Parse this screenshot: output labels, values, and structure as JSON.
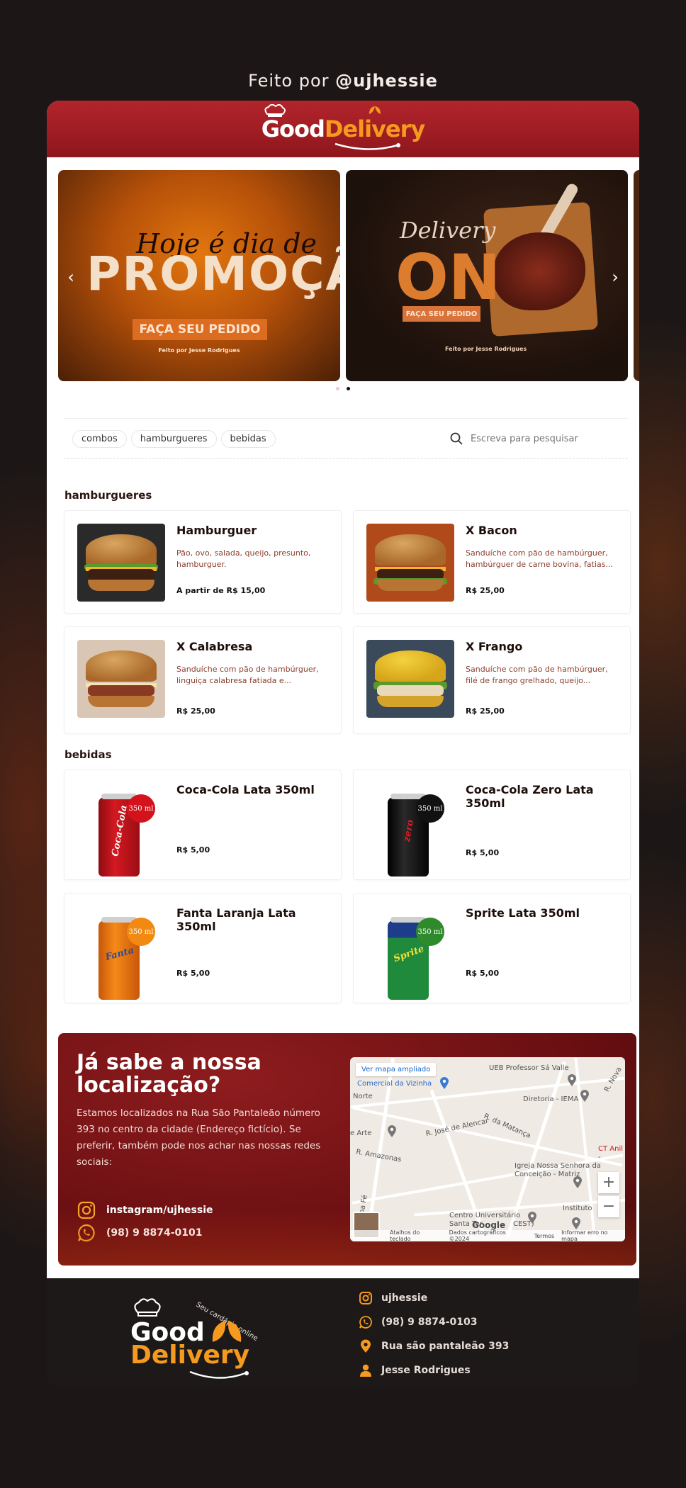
{
  "credit": {
    "prefix": "Feito por",
    "handle": "@ujhessie"
  },
  "header": {
    "logo_good": "Good",
    "logo_delivery": "Delivery"
  },
  "carousel": {
    "slide1": {
      "script": "Hoje é dia de",
      "big": "PROMOÇÃO",
      "cta": "FAÇA SEU PEDIDO",
      "by": "Feito por Jesse Rodrigues"
    },
    "slide2": {
      "script": "Delivery",
      "big": "ON",
      "cta": "FAÇA SEU PEDIDO",
      "by": "Feito por Jesse Rodrigues"
    },
    "prev_icon": "chevron-left-icon",
    "next_icon": "chevron-right-icon",
    "active_dot": 2,
    "dot_count": 2
  },
  "filters": {
    "chips": [
      "combos",
      "hamburgueres",
      "bebidas"
    ],
    "search_placeholder": "Escreva para pesquisar",
    "search_icon": "search-icon"
  },
  "sections": {
    "burgers": {
      "title": "hamburgueres",
      "items": [
        {
          "title": "Hamburguer",
          "desc": "Pão, ovo, salada, queijo, presunto, hamburguer.",
          "price": "A partir de R$ 15,00"
        },
        {
          "title": "X Bacon",
          "desc": "Sanduíche com pão de hambúrguer, hambúrguer de carne bovina, fatias...",
          "price": "R$ 25,00"
        },
        {
          "title": "X Calabresa",
          "desc": "Sanduíche com pão de hambúrguer, linguiça calabresa fatiada e...",
          "price": "R$ 25,00"
        },
        {
          "title": "X Frango",
          "desc": "Sanduíche com pão de hambúrguer, filé de frango grelhado, queijo...",
          "price": "R$ 25,00"
        }
      ]
    },
    "drinks": {
      "title": "bebidas",
      "items": [
        {
          "title": "Coca-Cola Lata 350ml",
          "price": "R$ 5,00",
          "badge": "350 ml",
          "badge_color": "#d4121b",
          "can_color": "#c8141c",
          "can_label": "Coca-Cola"
        },
        {
          "title": "Coca-Cola Zero Lata 350ml",
          "price": "R$ 5,00",
          "badge": "350 ml",
          "badge_color": "#111111",
          "can_color": "#1a1a1a",
          "can_label": "zero"
        },
        {
          "title": "Fanta Laranja Lata 350ml",
          "price": "R$ 5,00",
          "badge": "350 ml",
          "badge_color": "#f28a12",
          "can_color": "#f07a14",
          "can_label": "Fanta"
        },
        {
          "title": "Sprite Lata 350ml",
          "price": "R$ 5,00",
          "badge": "350 ml",
          "badge_color": "#2f8a2c",
          "can_color": "#1f7a32",
          "can_label": "Sprite"
        }
      ]
    }
  },
  "location": {
    "title": "Já sabe a nossa localização?",
    "text": "Estamos localizados na Rua São Pantaleão número 393 no centro da cidade (Endereço fictício). Se preferir, também pode nos achar nas nossas redes sociais:",
    "instagram": "instagram/ujhessie",
    "phone": "(98) 9 8874-0101",
    "map": {
      "ver_mapa": "Ver mapa ampliado",
      "labels": [
        "UEB Professor Sá Valle",
        "Comercial da Vizinha",
        "Norte",
        "Diretoria - IEMA",
        "R. Nova",
        "R. José de Alencar",
        "R. da Matança",
        "e Arte",
        "R. Amazonas",
        "CT Anil -",
        "Igreja Nossa Senhora da Conceição - Matriz",
        "Centro Universitário Santa Ter",
        "CEST)",
        "Instituto",
        "R. Boa Fé"
      ],
      "footer": [
        "Atalhos do teclado",
        "Dados cartográficos ©2024",
        "Termos",
        "Informar erro no mapa"
      ],
      "google": "Google",
      "zoom_in": "+",
      "zoom_out": "−"
    }
  },
  "footer": {
    "logo_good": "Good",
    "logo_delivery": "Delivery",
    "tagline": "Seu cardápio online",
    "instagram": "ujhessie",
    "whatsapp": "(98) 9 8874-0103",
    "address": "Rua são pantaleão 393",
    "author": "Jesse Rodrigues",
    "accent": "#f59a1e"
  }
}
